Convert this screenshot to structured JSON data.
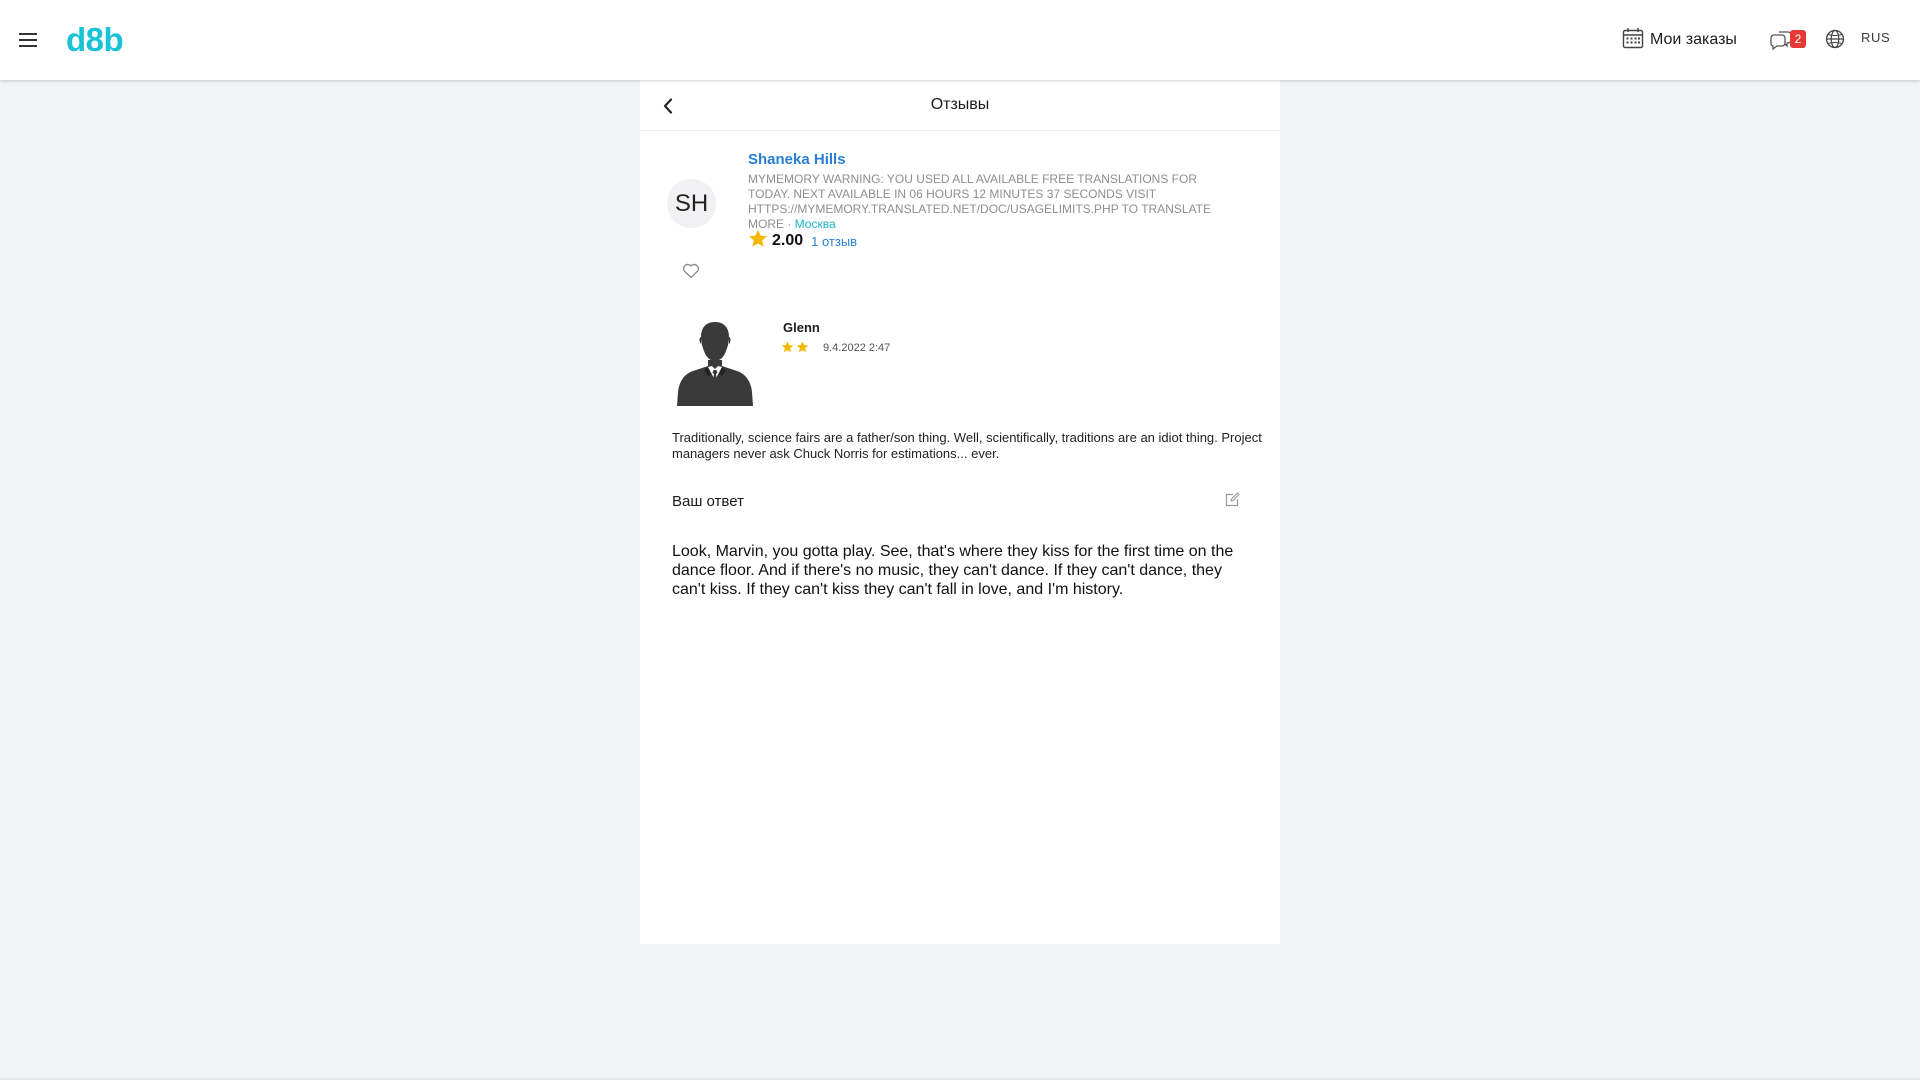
{
  "header": {
    "logo": "d8b",
    "logo_color": "#18c3d8",
    "menu_icon": "hamburger-menu-icon",
    "orders_label": "Мои заказы",
    "orders_icon": "calendar-icon",
    "chat_icon": "chat-bubbles-icon",
    "chat_badge": "2",
    "language_icon": "globe-icon",
    "language": "RUS"
  },
  "page": {
    "title": "Отзывы",
    "back_icon": "chevron-left-icon"
  },
  "profile": {
    "initials": "SH",
    "name": "Shaneka Hills",
    "description": "MYMEMORY WARNING: YOU USED ALL AVAILABLE FREE TRANSLATIONS FOR TODAY. NEXT AVAILABLE IN 06 HOURS 12 MINUTES 37 SECONDS VISIT HTTPS://MYMEMORY.TRANSLATED.NET/DOC/USAGELIMITS.PHP TO TRANSLATE MORE",
    "separator": " · ",
    "city": "Москва",
    "rating": "2.00",
    "reviews_count": "1 отзыв",
    "favorite_icon": "heart-outline-icon",
    "star_color": "#f5b800"
  },
  "review": {
    "reviewer_avatar": "person-silhouette-icon",
    "reviewer_name": "Glenn",
    "stars": 2,
    "date": "9.4.2022 2:47",
    "text": "Traditionally, science fairs are a father/son thing. Well, scientifically, traditions are an idiot thing. Project managers never ask Chuck Norris for estimations... ever."
  },
  "answer": {
    "label": "Ваш ответ",
    "edit_icon": "edit-pencil-icon",
    "text": "Look, Marvin, you gotta play. See, that's where they kiss for the first time on the dance floor. And if there's no music, they can't dance. If they can't dance, they can't kiss. If they can't kiss they can't fall in love, and I'm history."
  }
}
